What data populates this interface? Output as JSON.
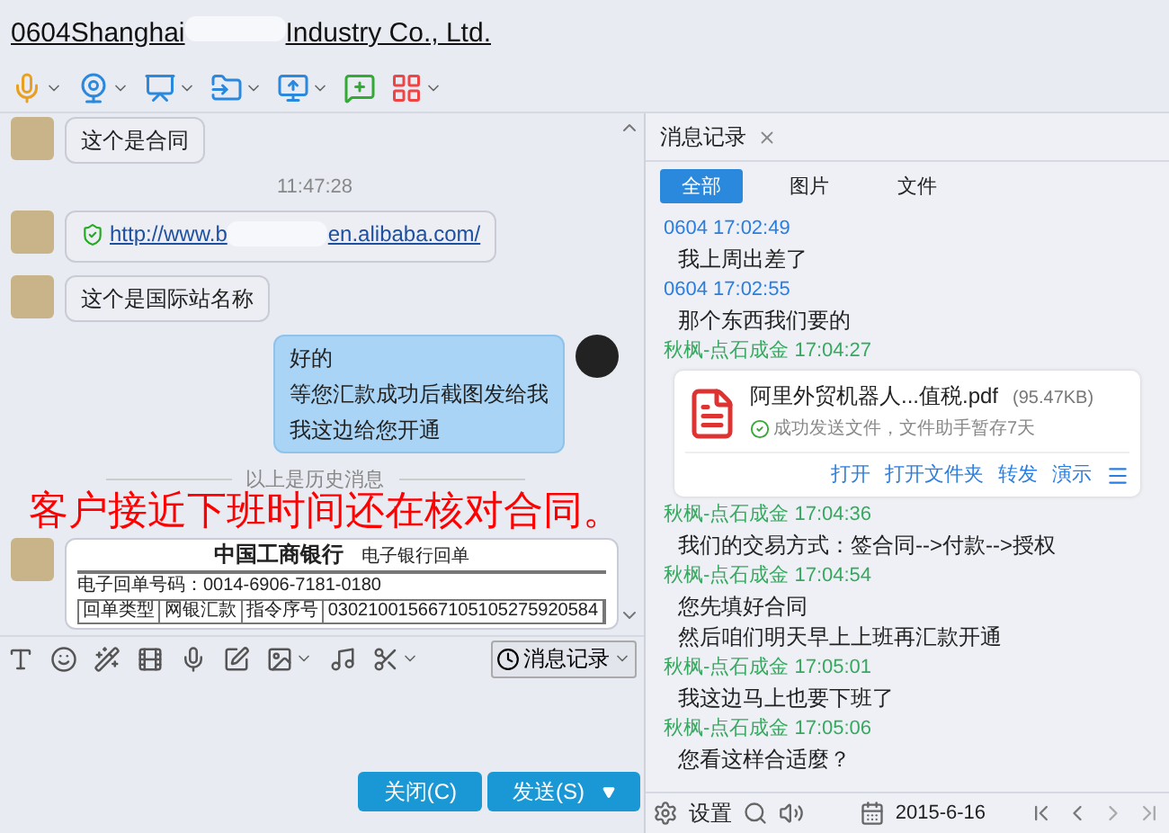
{
  "window": {
    "title_start": "0604Shanghai",
    "title_end": "Industry Co., Ltd."
  },
  "chat": {
    "messages": [
      {
        "kind": "text",
        "outgoing": false,
        "lines": [
          "这个是合同"
        ]
      },
      {
        "kind": "time",
        "text": "11:47:28"
      },
      {
        "kind": "link",
        "outgoing": false,
        "url_start": "http://www.b",
        "url_end": "en.alibaba.com/"
      },
      {
        "kind": "text",
        "outgoing": false,
        "lines": [
          "这个是国际站名称"
        ]
      },
      {
        "kind": "text",
        "outgoing": true,
        "lines": [
          "好的",
          "等您汇款成功后截图发给我",
          "我这边给您开通"
        ]
      },
      {
        "kind": "divider",
        "text": "以上是历史消息"
      },
      {
        "kind": "receipt",
        "outgoing": false,
        "bank": "中国工商银行",
        "doc": "电子银行回单",
        "number": "电子回单号码：0014-6906-7181-0180",
        "cells": [
          "回单类型",
          "网银汇款",
          "指令序号",
          "030210015667105105275920584"
        ]
      }
    ]
  },
  "history_button": "消息记录",
  "buttons": {
    "close": "关闭(C)",
    "send": "发送(S)"
  },
  "annotation": "客户接近下班时间还在核对合同。",
  "history": {
    "tab": "消息记录",
    "filters": [
      {
        "label": "全部",
        "selected": true
      },
      {
        "label": "图片",
        "selected": false
      },
      {
        "label": "文件",
        "selected": false
      }
    ],
    "entries": [
      {
        "kind": "self",
        "header": "0604 17:02:49",
        "lines": [
          "我上周出差了"
        ]
      },
      {
        "kind": "self",
        "header": "0604 17:02:55",
        "lines": [
          "那个东西我们要的"
        ]
      },
      {
        "kind": "other",
        "header": "秋枫-点石成金 17:04:27",
        "file": {
          "name": "阿里外贸机器人...值税.pdf",
          "size": "(95.47KB)",
          "status": "成功发送文件，文件助手暂存7天",
          "actions": [
            "打开",
            "打开文件夹",
            "转发",
            "演示"
          ]
        }
      },
      {
        "kind": "other",
        "header": "秋枫-点石成金 17:04:36",
        "lines": [
          "我们的交易方式：签合同-->付款-->授权"
        ]
      },
      {
        "kind": "other",
        "header": "秋枫-点石成金 17:04:54",
        "lines": [
          "您先填好合同",
          "然后咱们明天早上上班再汇款开通"
        ]
      },
      {
        "kind": "other",
        "header": "秋枫-点石成金 17:05:01",
        "lines": [
          "我这边马上也要下班了"
        ]
      },
      {
        "kind": "other",
        "header": "秋枫-点石成金 17:05:06",
        "lines": [
          "您看这样合适麼？"
        ]
      }
    ],
    "footer": {
      "settings": "设置",
      "date": "2015-6-16"
    }
  }
}
